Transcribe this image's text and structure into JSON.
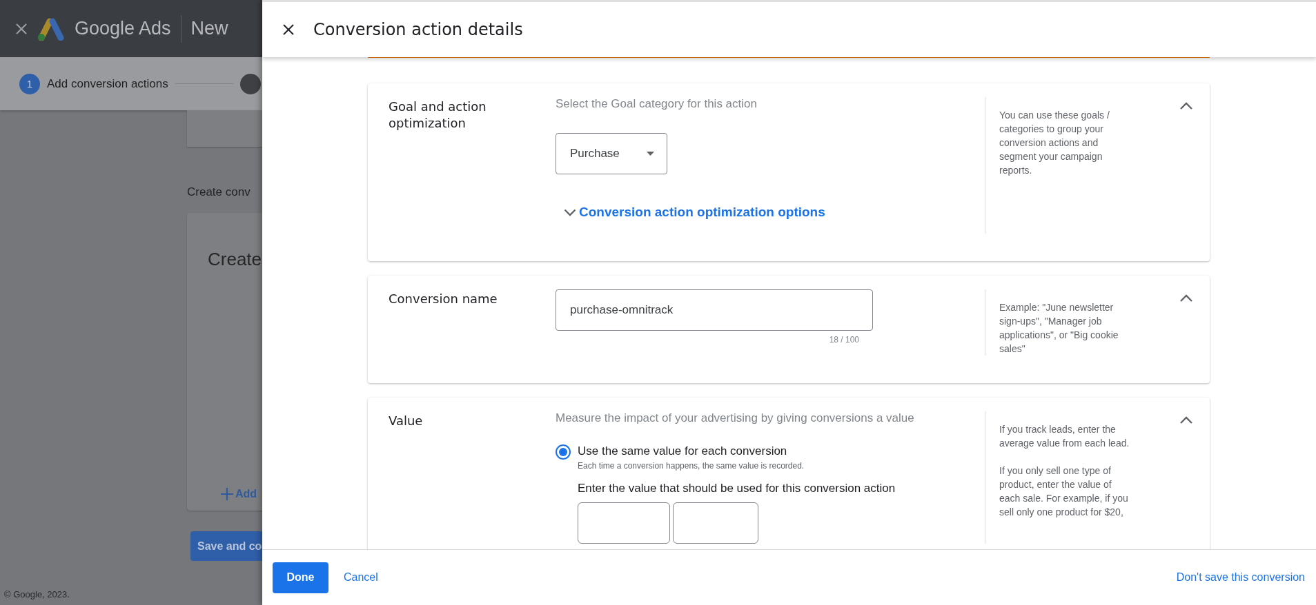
{
  "app_bar": {
    "product": "Google Ads",
    "section": "New"
  },
  "stepper": [
    {
      "number": "1",
      "label": "Add conversion actions",
      "selected": true
    },
    {
      "selected": false
    }
  ],
  "background": {
    "section_title": "Create conv",
    "card_title": "Create",
    "add_link": "Add",
    "save_button": "Save and co",
    "copyright": "© Google, 2023."
  },
  "panel": {
    "title": "Conversion action details",
    "sections": [
      {
        "kind": "select",
        "label": "Goal and action optimization",
        "description": "Select the Goal category for this action",
        "select_value": "Purchase",
        "expander": "Conversion action optimization options",
        "help": [
          "You can use these goals / categories to group your conversion actions and segment your campaign reports."
        ],
        "expanded": true
      },
      {
        "kind": "text",
        "label": "Conversion name",
        "field_value": "purchase-omnitrack",
        "counter": "18 / 100",
        "help": [
          "Example: \"June newsletter sign-ups\", \"Manager job applications\", or \"Big cookie sales\""
        ],
        "expanded": true
      },
      {
        "kind": "radio",
        "label": "Value",
        "description": "Measure the impact of your advertising by giving conversions a value",
        "options": [
          {
            "label": "Use the same value for each conversion",
            "sublabel": "Each time a conversion happens, the same value is recorded.",
            "selected": true
          }
        ],
        "prompt": "Enter the value that should be used for this conversion action",
        "help": [
          "If you track leads, enter the average value from each lead.",
          "If you only sell one type of product, enter the value of each sale. For example, if you sell only one product for $20,"
        ],
        "expanded": true
      }
    ],
    "footer": {
      "done": "Done",
      "cancel": "Cancel",
      "discard": "Don't save this conversion"
    }
  }
}
